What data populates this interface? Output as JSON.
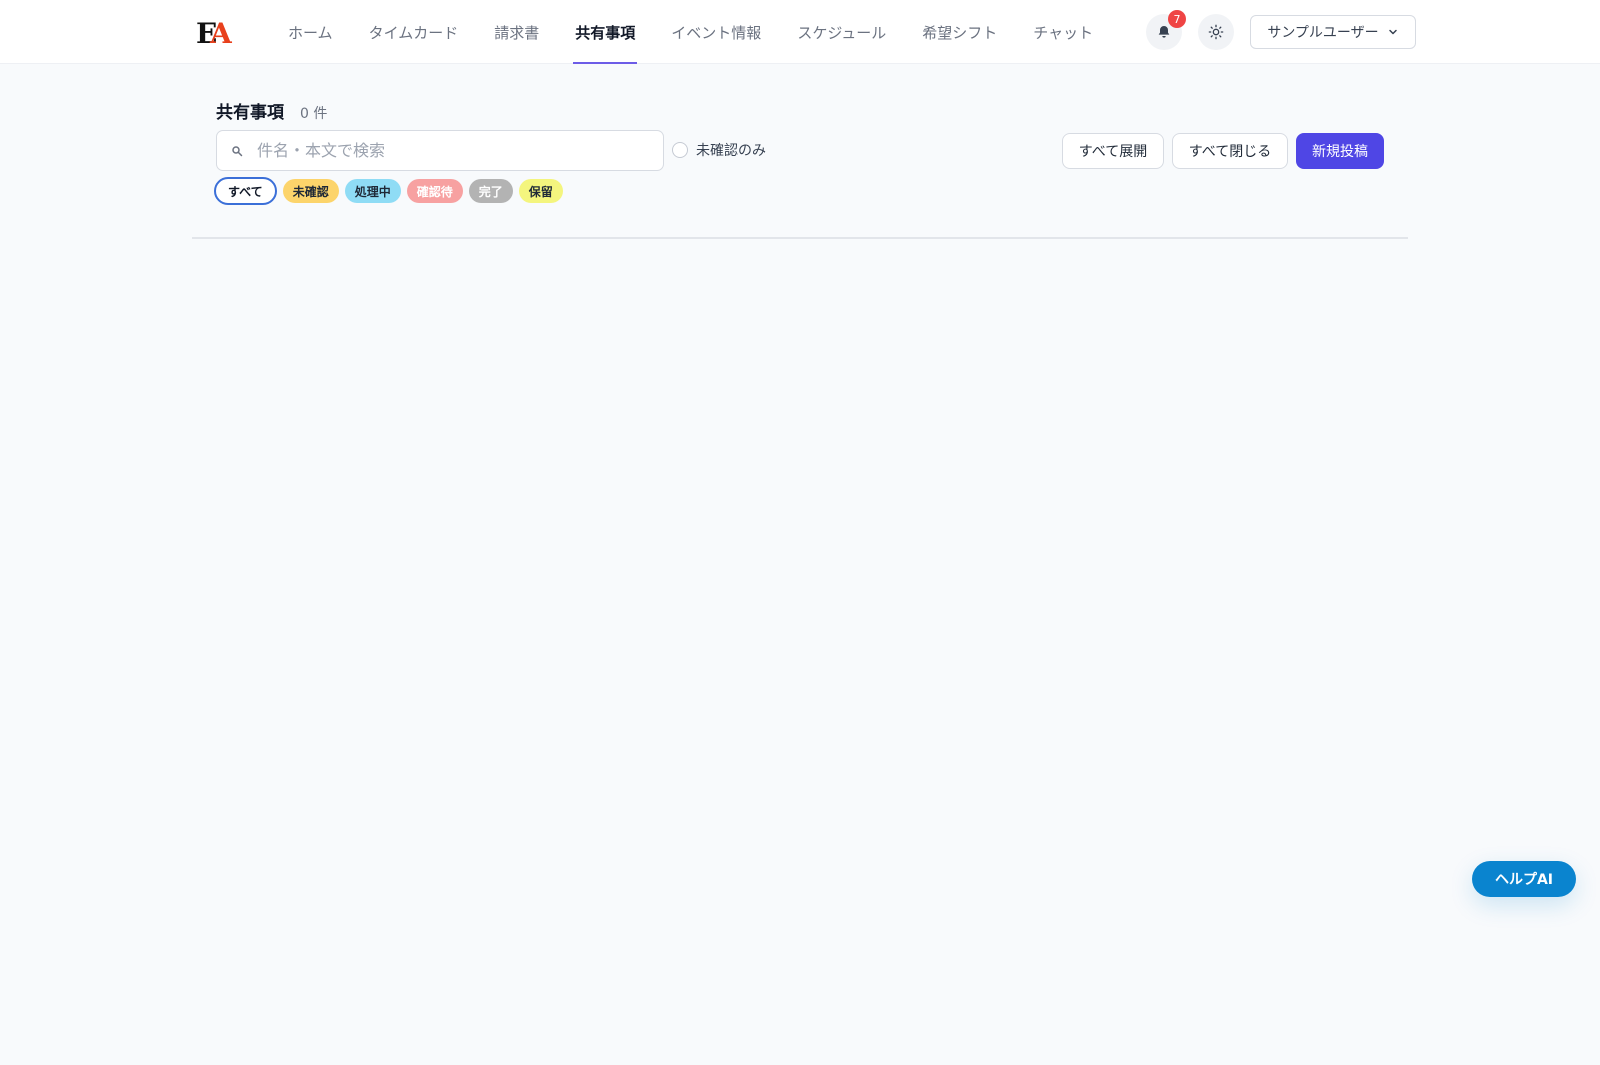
{
  "header": {
    "logo_text": "EA",
    "nav": [
      {
        "label": "ホーム"
      },
      {
        "label": "タイムカード"
      },
      {
        "label": "請求書"
      },
      {
        "label": "共有事項"
      },
      {
        "label": "イベント情報"
      },
      {
        "label": "スケジュール"
      },
      {
        "label": "希望シフト"
      },
      {
        "label": "チャット"
      }
    ],
    "active_nav": "共有事項",
    "notification_count": "7",
    "user_name": "サンプルユーザー"
  },
  "page": {
    "title": "共有事項",
    "count": "0 件"
  },
  "search": {
    "placeholder": "件名・本文で検索",
    "value": ""
  },
  "unconfirmed_only": {
    "label": "未確認のみ",
    "checked": false
  },
  "actions": {
    "expand_all": "すべて展開",
    "collapse_all": "すべて閉じる",
    "new_post": "新規投稿"
  },
  "filters": [
    {
      "label": "すべて",
      "selected": true,
      "bg": "#ffffff",
      "fg": "#111827"
    },
    {
      "label": "未確認",
      "selected": false,
      "bg": "#fcd46b",
      "fg": "#1f2937"
    },
    {
      "label": "処理中",
      "selected": false,
      "bg": "#8fdcf5",
      "fg": "#1f2937"
    },
    {
      "label": "確認待",
      "selected": false,
      "bg": "#f7a1a1",
      "fg": "#ffffff"
    },
    {
      "label": "完了",
      "selected": false,
      "bg": "#b3b3b3",
      "fg": "#ffffff"
    },
    {
      "label": "保留",
      "selected": false,
      "bg": "#f4f57e",
      "fg": "#1f2937"
    }
  ],
  "help": {
    "label": "ヘルプAI"
  },
  "colors": {
    "primary": "#4f46e5",
    "help": "#0a84cf",
    "badge": "#ef4444",
    "nav_active_underline": "#6d5ce7"
  },
  "icons": {
    "search": "search-icon",
    "bell": "bell-icon",
    "theme": "sun-icon",
    "user_caret": "chevron-down-icon"
  }
}
